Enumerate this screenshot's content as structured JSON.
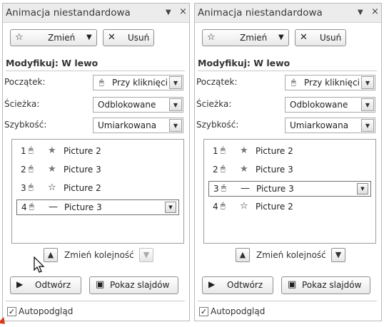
{
  "panes": [
    {
      "title": "Animacja niestandardowa",
      "title_ctrl_dropdown": "▼",
      "title_ctrl_close": "×",
      "change_button": "Zmień",
      "remove_button": "Usuń",
      "modify_title": "Modyfikuj: W lewo",
      "props": [
        {
          "label": "Początek:",
          "value": "Przy kliknięciu"
        },
        {
          "label": "Ścieżka:",
          "value": "Odblokowane"
        },
        {
          "label": "Szybkość:",
          "value": "Umiarkowana"
        }
      ],
      "items": [
        {
          "num": "1",
          "effect_icon": "star-effect-icon",
          "effect_glyph": "★",
          "name": "Picture 2",
          "selected": false
        },
        {
          "num": "2",
          "effect_icon": "star-effect-icon",
          "effect_glyph": "★",
          "name": "Picture 3",
          "selected": false
        },
        {
          "num": "3",
          "effect_icon": "star-outline-effect-icon",
          "effect_glyph": "☆",
          "name": "Picture 2",
          "selected": false
        },
        {
          "num": "4",
          "effect_icon": "motion-path-icon",
          "effect_glyph": "—",
          "name": "Picture 3",
          "selected": true
        }
      ],
      "reorder_label": "Zmień kolejność",
      "play_button": "Odtwórz",
      "slideshow_button": "Pokaz slajdów",
      "autopreview_label": "Autopodgląd",
      "autopreview_checked": true
    },
    {
      "title": "Animacja niestandardowa",
      "title_ctrl_dropdown": "▼",
      "title_ctrl_close": "×",
      "change_button": "Zmień",
      "remove_button": "Usuń",
      "modify_title": "Modyfikuj: W lewo",
      "props": [
        {
          "label": "Początek:",
          "value": "Przy kliknięciu"
        },
        {
          "label": "Ścieżka:",
          "value": "Odblokowane"
        },
        {
          "label": "Szybkość:",
          "value": "Umiarkowana"
        }
      ],
      "items": [
        {
          "num": "1",
          "effect_icon": "star-effect-icon",
          "effect_glyph": "★",
          "name": "Picture 2",
          "selected": false
        },
        {
          "num": "2",
          "effect_icon": "star-effect-icon",
          "effect_glyph": "★",
          "name": "Picture 3",
          "selected": false
        },
        {
          "num": "3",
          "effect_icon": "motion-path-icon",
          "effect_glyph": "—",
          "name": "Picture 3",
          "selected": true
        },
        {
          "num": "4",
          "effect_icon": "star-outline-effect-icon",
          "effect_glyph": "☆",
          "name": "Picture 2",
          "selected": false
        }
      ],
      "reorder_label": "Zmień kolejność",
      "play_button": "Odtwórz",
      "slideshow_button": "Pokaz slajdów",
      "autopreview_label": "Autopodgląd",
      "autopreview_checked": true
    }
  ],
  "glyphs": {
    "change_icon": "☆",
    "remove_icon": "✕",
    "mouse_icon": "🖱",
    "dropdown": "▼",
    "up": "▲",
    "down": "▼",
    "play": "▶",
    "slideshow": "▣",
    "check": "✓"
  }
}
